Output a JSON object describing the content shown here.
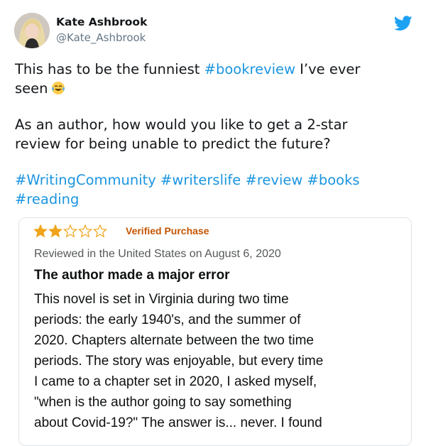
{
  "tweet": {
    "author_name": "Kate Ashbrook",
    "author_handle": "@Kate_Ashbrook",
    "brand_color": "#1da1f2",
    "hashtag_color": "#1b95e0",
    "line1_text": "This has to be the funniest ",
    "line1_hashtag": "#bookreview",
    "line1_suffix": " I’ve ever",
    "line2_text": "seen",
    "line2_emoji": "face-with-tears-of-joy-icon",
    "line3": "As an author, how would you like to get a 2-star",
    "line4": "review for being unable to predict the future?",
    "hashtags_line1": [
      "#WritingCommunity",
      "#writerslife",
      "#review",
      "#books"
    ],
    "hashtags_line2": [
      "#reading"
    ]
  },
  "review": {
    "rating": 2,
    "max_rating": 5,
    "star_color": "#f0a41b",
    "verified_label": "Verified Purchase",
    "verified_color": "#c45500",
    "reviewed_line": "Reviewed in the United States on August 6, 2020",
    "title": "The author made a major error",
    "body_lines": [
      "This novel is set in Virginia during two time",
      "periods: the early 1940's, and the summer of",
      "2020. Chapters alternate between the two time",
      "periods. The story was enjoyable, but every time",
      "I came to a chapter set in 2020, I asked myself,",
      "\"when is the author going to say something",
      "about Covid-19?\" The answer is... never. I found"
    ]
  }
}
